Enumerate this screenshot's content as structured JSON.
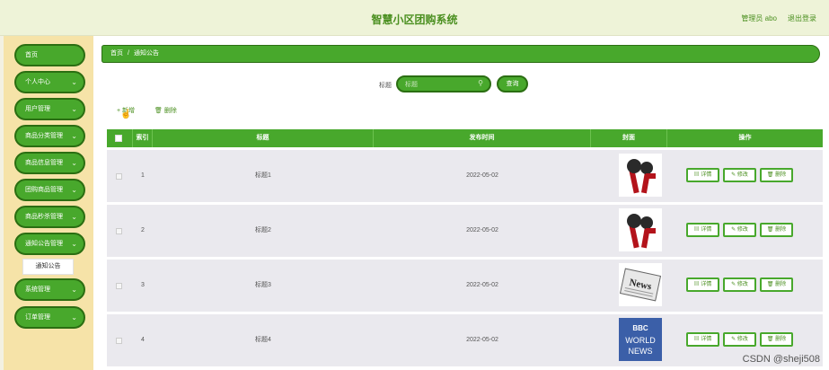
{
  "header": {
    "title": "智慧小区团购系统",
    "user": "管理员 abo",
    "logout": "退出登录"
  },
  "sidebar": {
    "items": [
      {
        "label": "首页",
        "chevron": false
      },
      {
        "label": "个人中心",
        "chevron": true
      },
      {
        "label": "用户管理",
        "chevron": true
      },
      {
        "label": "商品分类管理",
        "chevron": true
      },
      {
        "label": "商品信息管理",
        "chevron": true
      },
      {
        "label": "团购商品管理",
        "chevron": true
      },
      {
        "label": "商品秒杀管理",
        "chevron": true
      },
      {
        "label": "通知公告管理",
        "chevron": true
      },
      {
        "label": "系统管理",
        "chevron": true
      },
      {
        "label": "订单管理",
        "chevron": true
      }
    ],
    "sub_item": "通知公告"
  },
  "breadcrumb": {
    "home": "首页",
    "separator": "/",
    "current": "通知公告"
  },
  "search": {
    "label": "标题",
    "placeholder": "标题",
    "button": "查询"
  },
  "toolbar": {
    "add": "+ 新增",
    "delete": "删除"
  },
  "table": {
    "columns": [
      "索引",
      "标题",
      "发布时间",
      "封面",
      "操作"
    ],
    "rows": [
      {
        "index": "1",
        "title": "标题1",
        "time": "2022-05-02",
        "cover": "microphone-image"
      },
      {
        "index": "2",
        "title": "标题2",
        "time": "2022-05-02",
        "cover": "microphone-image"
      },
      {
        "index": "3",
        "title": "标题3",
        "time": "2022-05-02",
        "cover": "newspaper-image"
      },
      {
        "index": "4",
        "title": "标题4",
        "time": "2022-05-02",
        "cover": "world-news-image"
      }
    ],
    "actions": {
      "detail": "详情",
      "edit": "修改",
      "delete": "删除"
    },
    "cover_texts": {
      "news": "News",
      "bbc": "BBC",
      "world": "WORLD",
      "news_caps": "NEWS"
    }
  },
  "watermark": "CSDN @sheji508",
  "colors": {
    "accent": "#48a82c",
    "accent_dark": "#2b6e12",
    "sidebar": "#f6e3a8"
  }
}
